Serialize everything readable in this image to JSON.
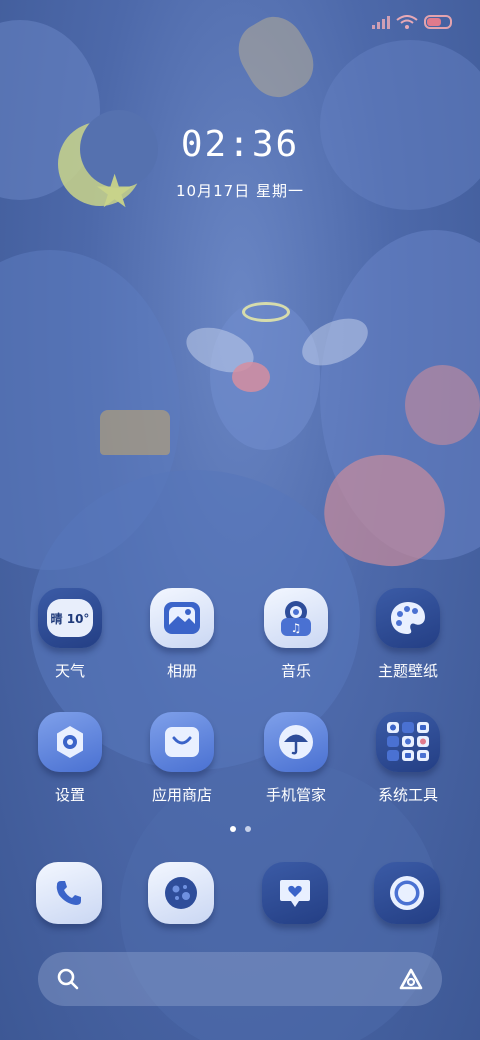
{
  "status_bar": {
    "battery_level": 0.72,
    "signal_icon": "signal-icon",
    "wifi_icon": "wifi-icon"
  },
  "lock": {
    "time": "02:36",
    "date": "10月17日  星期一"
  },
  "apps": [
    {
      "name": "weather",
      "label": "天气",
      "icon": "weather-icon",
      "widget_text": "晴 10°"
    },
    {
      "name": "gallery",
      "label": "相册",
      "icon": "gallery-icon"
    },
    {
      "name": "music",
      "label": "音乐",
      "icon": "music-icon"
    },
    {
      "name": "themes",
      "label": "主题壁纸",
      "icon": "palette-icon"
    },
    {
      "name": "settings",
      "label": "设置",
      "icon": "gear-icon"
    },
    {
      "name": "app-store",
      "label": "应用商店",
      "icon": "shopping-bag-icon"
    },
    {
      "name": "security",
      "label": "手机管家",
      "icon": "umbrella-icon"
    },
    {
      "name": "system-tools",
      "label": "系统工具",
      "icon": "folder-icon"
    }
  ],
  "page_indicator": {
    "pages": 2,
    "current": 1
  },
  "dock": [
    {
      "name": "phone",
      "icon": "phone-icon"
    },
    {
      "name": "browser",
      "icon": "browser-icon"
    },
    {
      "name": "messages",
      "icon": "message-heart-icon"
    },
    {
      "name": "camera",
      "icon": "camera-icon"
    }
  ],
  "search": {
    "left_icon": "search-icon",
    "right_icon": "assistant-icon"
  },
  "colors": {
    "accent": "#4a71d2",
    "icon_dark": "#243f85",
    "battery": "#e07a8c"
  }
}
